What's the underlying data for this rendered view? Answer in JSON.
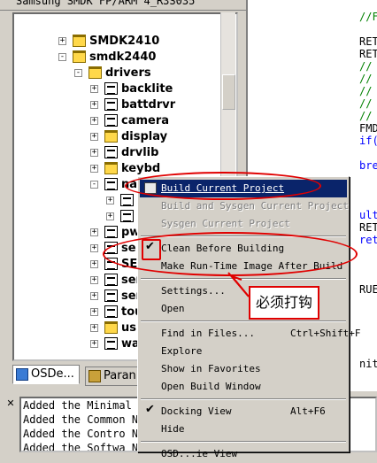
{
  "titlebar": {
    "text": "Samsung SMDK FP/ARM 4_R3S035"
  },
  "tree": {
    "items": [
      {
        "label": "SMDK2410",
        "type": "folder",
        "expander": "+"
      },
      {
        "label": "smdk2440",
        "type": "folder",
        "expander": "-"
      },
      {
        "label": "drivers",
        "type": "folder",
        "expander": "-"
      },
      {
        "label": "backlite",
        "type": "project",
        "expander": "+"
      },
      {
        "label": "battdrvr",
        "type": "project",
        "expander": "+"
      },
      {
        "label": "camera",
        "type": "project",
        "expander": "+"
      },
      {
        "label": "display",
        "type": "folder",
        "expander": "+"
      },
      {
        "label": "drvlib",
        "type": "project",
        "expander": "+"
      },
      {
        "label": "keybd",
        "type": "folder",
        "expander": "+"
      },
      {
        "label": "nand",
        "type": "project",
        "expander": "-"
      },
      {
        "label": "",
        "type": "project",
        "expander": "+"
      },
      {
        "label": "",
        "type": "project",
        "expander": "+"
      },
      {
        "label": "pw",
        "type": "project",
        "expander": "+"
      },
      {
        "label": "se",
        "type": "project",
        "expander": "+"
      },
      {
        "label": "SE",
        "type": "project",
        "expander": "+"
      },
      {
        "label": "ser",
        "type": "project",
        "expander": "+"
      },
      {
        "label": "ser",
        "type": "project",
        "expander": "+"
      },
      {
        "label": "tou",
        "type": "project",
        "expander": "+"
      },
      {
        "label": "usl",
        "type": "folder",
        "expander": "+"
      },
      {
        "label": "wav",
        "type": "project",
        "expander": "+"
      }
    ]
  },
  "tabs": [
    {
      "label": "OSDe..."
    },
    {
      "label": "Paran"
    }
  ],
  "code": {
    "lines": [
      {
        "text": "//F",
        "cls": "cm"
      },
      {
        "text": "",
        "cls": "tx"
      },
      {
        "text": "RET",
        "cls": "tx"
      },
      {
        "text": "RET",
        "cls": "tx"
      },
      {
        "text": "//",
        "cls": "cm"
      },
      {
        "text": "//",
        "cls": "cm"
      },
      {
        "text": "//",
        "cls": "cm"
      },
      {
        "text": "//",
        "cls": "cm"
      },
      {
        "text": "//",
        "cls": "cm"
      },
      {
        "text": "FMD",
        "cls": "tx"
      },
      {
        "text": "if(",
        "cls": "kw"
      },
      {
        "text": "",
        "cls": "tx"
      },
      {
        "text": "bre",
        "cls": "kw"
      },
      {
        "text": "",
        "cls": "tx"
      },
      {
        "text": "",
        "cls": "tx"
      },
      {
        "text": "",
        "cls": "tx"
      },
      {
        "text": "ult:",
        "cls": "kw"
      },
      {
        "text": "RETA",
        "cls": "tx"
      },
      {
        "text": "retu",
        "cls": "kw"
      },
      {
        "text": "",
        "cls": "tx"
      },
      {
        "text": "",
        "cls": "tx"
      },
      {
        "text": "",
        "cls": "tx"
      },
      {
        "text": "RUE;",
        "cls": "tx"
      },
      {
        "text": "",
        "cls": "tx"
      },
      {
        "text": "",
        "cls": "tx"
      },
      {
        "text": "",
        "cls": "tx"
      },
      {
        "text": "",
        "cls": "tx"
      },
      {
        "text": "",
        "cls": "tx"
      },
      {
        "text": "nit(",
        "cls": "tx"
      }
    ]
  },
  "output": {
    "lines": [
      "Added the Minimal Feature",
      "Added the Common N_CO",
      "Added the Contro N_CT",
      "Added the Softwa N_C"
    ]
  },
  "menu": {
    "items": [
      {
        "label": "Build Current Project",
        "shortcut": "",
        "state": "highlight",
        "icon": true
      },
      {
        "label": "Build and Sysgen Current Project",
        "shortcut": "",
        "state": "disabled"
      },
      {
        "label": "Sysgen Current Project",
        "shortcut": "",
        "state": "disabled"
      },
      {
        "sep": true
      },
      {
        "label": "Clean Before Building",
        "shortcut": "",
        "state": "normal",
        "checked": true
      },
      {
        "label": "Make Run-Time Image After Build",
        "shortcut": "",
        "state": "normal"
      },
      {
        "sep": true
      },
      {
        "label": "Settings...",
        "shortcut": "",
        "state": "normal"
      },
      {
        "label": "Open",
        "shortcut": "",
        "state": "normal"
      },
      {
        "sep": true
      },
      {
        "label": "Find in Files...",
        "shortcut": "Ctrl+Shift+F",
        "state": "normal"
      },
      {
        "label": "Explore",
        "shortcut": "",
        "state": "normal"
      },
      {
        "label": "Show in Favorites",
        "shortcut": "",
        "state": "normal"
      },
      {
        "label": "Open Build Window",
        "shortcut": "",
        "state": "normal"
      },
      {
        "sep": true
      },
      {
        "label": "Docking View",
        "shortcut": "Alt+F6",
        "state": "normal",
        "checked": true
      },
      {
        "label": "Hide",
        "shortcut": "",
        "state": "normal"
      },
      {
        "sep": true
      },
      {
        "label": "OSD...ie View",
        "shortcut": "",
        "state": "normal"
      }
    ]
  },
  "annotation": {
    "callout_text": "必须打钩",
    "color": "#e00000"
  },
  "colors": {
    "highlight": "#0a246a",
    "comment": "#008000",
    "keyword": "#0000ff"
  }
}
